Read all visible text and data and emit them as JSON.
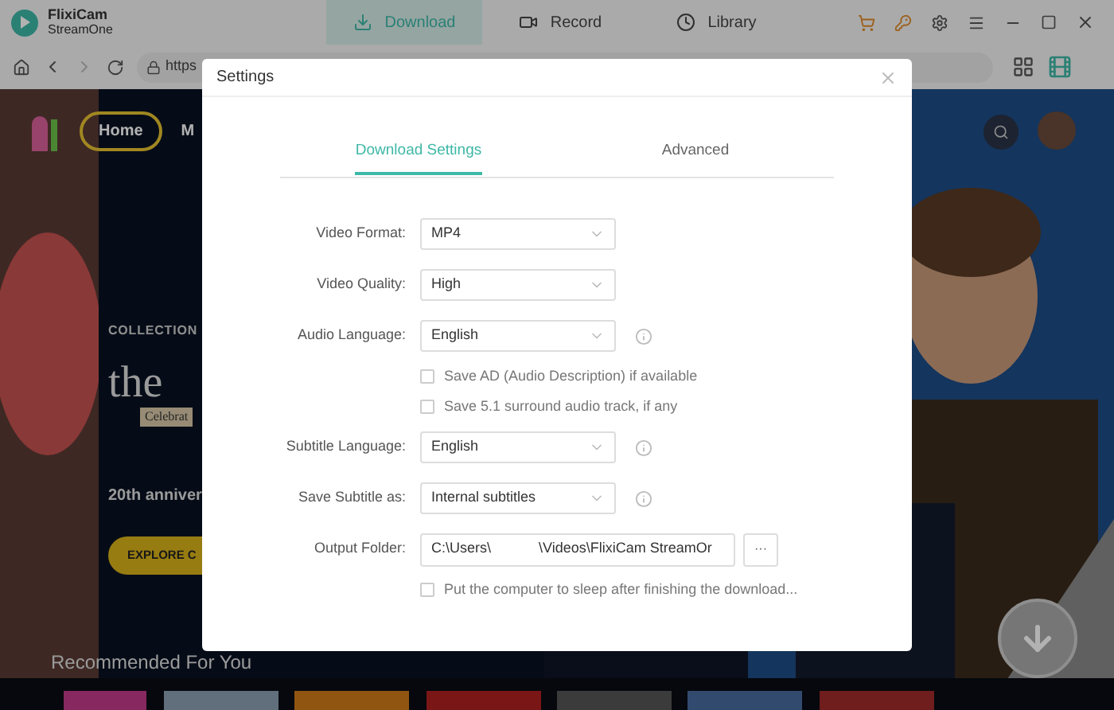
{
  "app": {
    "name": "FlixiCam",
    "subtitle": "StreamOne"
  },
  "nav_tabs": [
    {
      "label": "Download",
      "kind": "download",
      "selected": true
    },
    {
      "label": "Record",
      "kind": "record",
      "selected": false
    },
    {
      "label": "Library",
      "kind": "library",
      "selected": false
    }
  ],
  "address": {
    "url": "https"
  },
  "site": {
    "nav": [
      {
        "label": "Home",
        "selected": true
      },
      {
        "label": "M",
        "selected": false
      }
    ],
    "eyebrow": "COLLECTION",
    "headline": "the",
    "tag": "Celebrat",
    "caption": "20th anniver",
    "cta": "EXPLORE C",
    "section": "Recommended For You"
  },
  "dialog": {
    "title": "Settings",
    "tabs": [
      {
        "label": "Download Settings",
        "selected": true
      },
      {
        "label": "Advanced",
        "selected": false
      }
    ],
    "rows": [
      {
        "kind": "select",
        "label": "Video Format:",
        "value": "MP4",
        "info": false
      },
      {
        "kind": "select",
        "label": "Video Quality:",
        "value": "High",
        "info": false
      },
      {
        "kind": "select",
        "label": "Audio Language:",
        "value": "English",
        "info": true
      },
      {
        "kind": "checkbox",
        "label": "Save AD (Audio Description) if available",
        "checked": false
      },
      {
        "kind": "checkbox",
        "label": "Save 5.1 surround audio track, if any",
        "checked": false
      },
      {
        "kind": "select",
        "label": "Subtitle Language:",
        "value": "English",
        "info": true
      },
      {
        "kind": "select",
        "label": "Save Subtitle as:",
        "value": "Internal subtitles",
        "info": true
      },
      {
        "kind": "folder",
        "label": "Output Folder:",
        "value": "C:\\Users\\            \\Videos\\FlixiCam StreamOr",
        "browse": "···"
      },
      {
        "kind": "checkbox",
        "label": "Put the computer to sleep after finishing the download...",
        "checked": false
      }
    ]
  }
}
